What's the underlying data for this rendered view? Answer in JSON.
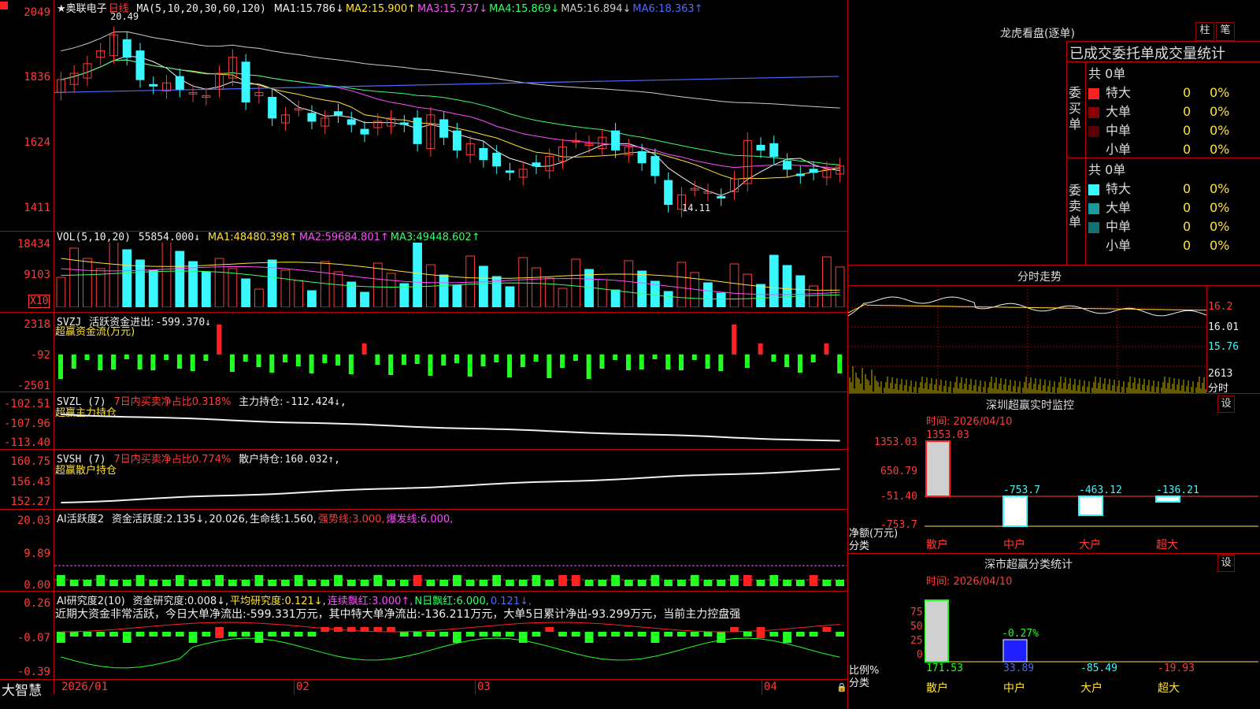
{
  "colors": {
    "up": "#ff3b3b",
    "down": "#39f7ff",
    "grid": "#c00000",
    "bg": "#000000"
  },
  "kline": {
    "stock_name": "★奥联电子",
    "period": "日线",
    "ma_label": "MA(5,10,20,30,60,120)",
    "ma": [
      {
        "name": "MA1:",
        "value": "15.786↓",
        "color": "#f0f0f0"
      },
      {
        "name": "MA2:",
        "value": "15.900↑",
        "color": "#ffe23a"
      },
      {
        "name": "MA3:",
        "value": "15.737↓",
        "color": "#ff4dff"
      },
      {
        "name": "MA4:",
        "value": "15.869↓",
        "color": "#39ff6a"
      },
      {
        "name": "MA5:",
        "value": "16.894↓",
        "color": "#cccccc"
      },
      {
        "name": "MA6:",
        "value": "18.363↑",
        "color": "#4d6bff"
      }
    ],
    "y_ticks": [
      "2049",
      "1836",
      "1624",
      "1411"
    ],
    "high_label": "20.49",
    "low_label": "14.11"
  },
  "vol": {
    "label": "VOL(5,10,20)",
    "value": "55854.000↓",
    "ma": [
      {
        "name": "MA1:",
        "value": "48480.398↑",
        "color": "#ffe23a"
      },
      {
        "name": "MA2:",
        "value": "59684.801↑",
        "color": "#ff4dff"
      },
      {
        "name": "MA3:",
        "value": "49448.602↑",
        "color": "#39ff6a"
      }
    ],
    "y_ticks": [
      "18434",
      "9103"
    ],
    "unit": "X10"
  },
  "svzj": {
    "label": "SVZJ",
    "title": "活跃资金进出:",
    "value": "-599.370↓",
    "sub": "超赢资金流(万元)",
    "y_ticks": [
      "2318",
      "-92",
      "-2501"
    ]
  },
  "svzl": {
    "label": "SVZL (7)",
    "title": "7日内买卖净占比0.318%",
    "name": "主力持仓:",
    "value": "-112.424↓,",
    "sub": "超赢主力持仓",
    "y_ticks": [
      "-102.51",
      "-107.96",
      "-113.40"
    ]
  },
  "svsh": {
    "label": "SVSH (7)",
    "title": "7日内买卖净占比0.774%",
    "name": "散户持仓:",
    "value": "160.032↑,",
    "sub": "超赢散户持仓",
    "y_ticks": [
      "160.75",
      "156.43",
      "152.27"
    ]
  },
  "ai1": {
    "label": "AI活跃度2",
    "items": [
      {
        "t": "资金活跃度:",
        "v": "2.135↓,",
        "c": "#f0f0f0"
      },
      {
        "t": "",
        "v": "20.026,",
        "c": "#f0f0f0"
      },
      {
        "t": "生命线:",
        "v": "1.560,",
        "c": "#f0f0f0"
      },
      {
        "t": "强势线:",
        "v": "3.000,",
        "c": "#ff3b3b"
      },
      {
        "t": "爆发线:",
        "v": "6.000,",
        "c": "#ff4dff"
      }
    ],
    "y_ticks": [
      "20.03",
      "9.89",
      "0.00"
    ]
  },
  "ai2": {
    "label": "AI研究度2(10)",
    "items": [
      {
        "t": "资金研究度:",
        "v": "0.008↓,",
        "c": "#f0f0f0"
      },
      {
        "t": "平均研究度:",
        "v": "0.121↓,",
        "c": "#ffe23a"
      },
      {
        "t": "连续飘红:",
        "v": "3.000↑,",
        "c": "#ff4dff"
      },
      {
        "t": "N日飘红:",
        "v": "6.000,",
        "c": "#39ff6a"
      },
      {
        "t": "",
        "v": "0.121↓,",
        "c": "#4d6bff"
      }
    ],
    "comment": "近期大资金非常活跃，今日大单净流出:-599.331万元，其中特大单净流出:-136.211万元，大单5日累计净出-93.299万元，当前主力控盘强",
    "y_ticks": [
      "0.26",
      "-0.07",
      "-0.39"
    ]
  },
  "xaxis": {
    "brand": "大智慧",
    "labels": [
      "2026/01",
      "02",
      "03",
      "04"
    ]
  },
  "right": {
    "lhkp_title": "龙虎看盘(逐单)",
    "btn_zhu": "柱",
    "btn_bi": "笔",
    "stat_title": "已成交委托单成交量统计",
    "buy_side": "委买单",
    "sell_side": "委卖单",
    "buy_total": "共 0单",
    "sell_total": "共 0单",
    "buy_rows": [
      {
        "label": "特大",
        "count": "0",
        "pct": "0%",
        "color": "#ff2020"
      },
      {
        "label": "大单",
        "count": "0",
        "pct": "0%",
        "color": "#8a0000"
      },
      {
        "label": "中单",
        "count": "0",
        "pct": "0%",
        "color": "#5a0000"
      },
      {
        "label": "小单",
        "count": "0",
        "pct": "0%",
        "color": "#000000"
      }
    ],
    "sell_rows": [
      {
        "label": "特大",
        "count": "0",
        "pct": "0%",
        "color": "#39f7ff"
      },
      {
        "label": "大单",
        "count": "0",
        "pct": "0%",
        "color": "#1a9a9a"
      },
      {
        "label": "中单",
        "count": "0",
        "pct": "0%",
        "color": "#127070"
      },
      {
        "label": "小单",
        "count": "0",
        "pct": "0%",
        "color": "#000000"
      }
    ],
    "fs_title": "分时走势",
    "fs_prices": [
      "16.2",
      "16.01",
      "15.76"
    ],
    "fs_vol": "2613",
    "fs_vol_unit": "分时",
    "monitor_title": "深圳超赢实时监控",
    "monitor_btn": "设",
    "monitor_time": "时间: 2026/04/10",
    "monitor_y": [
      "1353.03",
      "650.79",
      "-51.40",
      "-753.7"
    ],
    "monitor_unit1": "净额(万元)",
    "monitor_unit2": "分类",
    "monitor_bars": [
      {
        "cat": "散户",
        "value": "1353.03"
      },
      {
        "cat": "中户",
        "value": "-753.7"
      },
      {
        "cat": "大户",
        "value": "-463.12"
      },
      {
        "cat": "超大",
        "value": "-136.21"
      }
    ],
    "cls_title": "深市超赢分类统计",
    "cls_btn": "设",
    "cls_time": "时间: 2026/04/10",
    "cls_y": [
      "75",
      "50",
      "25",
      "0"
    ],
    "cls_unit1": "比例%",
    "cls_unit2": "分类",
    "cls_mid_label": "-0.27%",
    "cls_bars": [
      {
        "cat": "散户",
        "value": "171.53"
      },
      {
        "cat": "中户",
        "value": "33.89"
      },
      {
        "cat": "大户",
        "value": "-85.49"
      },
      {
        "cat": "超大",
        "value": "-19.93"
      }
    ]
  }
}
